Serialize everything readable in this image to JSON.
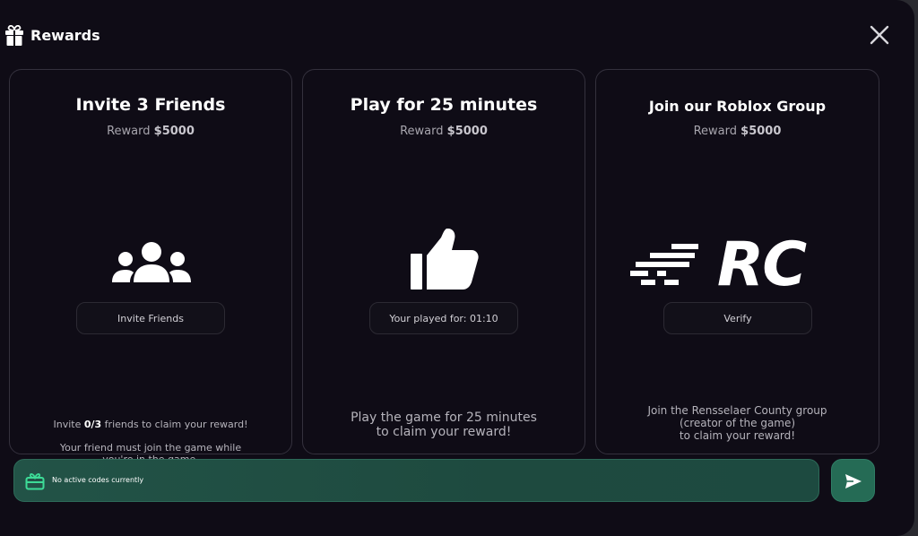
{
  "header": {
    "title": "Rewards",
    "icon": "gift-icon"
  },
  "cards": [
    {
      "title": "Invite 3 Friends",
      "reward_label": "Reward",
      "reward_amount": "$5000",
      "icon": "users-icon",
      "button_label": "Invite Friends",
      "desc_line1_pre": "Invite ",
      "desc_line1_bold": "0/3",
      "desc_line1_post": " friends to claim your reward!",
      "desc_rest": "Your friend must join the game while\nyou're in the game."
    },
    {
      "title": "Play for 25 minutes",
      "reward_label": "Reward",
      "reward_amount": "$5000",
      "icon": "thumbs-up-icon",
      "button_label": "Your played for: 01:10",
      "description": "Play the game for 25 minutes\nto claim your reward!"
    },
    {
      "title": "Join our Roblox Group",
      "reward_label": "Reward",
      "reward_amount": "$5000",
      "icon": "rc-logo",
      "logo_text": "RC",
      "button_label": "Verify",
      "description": "Join the Rensselaer County group\n(creator of the game)\nto claim your reward!"
    }
  ],
  "codes": {
    "icon": "ticket-icon",
    "status_text": "No active codes currently"
  },
  "send_button": {
    "icon": "send-icon"
  },
  "colors": {
    "background": "#0f0c16",
    "card_border": "#34313d",
    "codes_bar": "#1f4b40",
    "accent_green": "#3ddc97"
  }
}
